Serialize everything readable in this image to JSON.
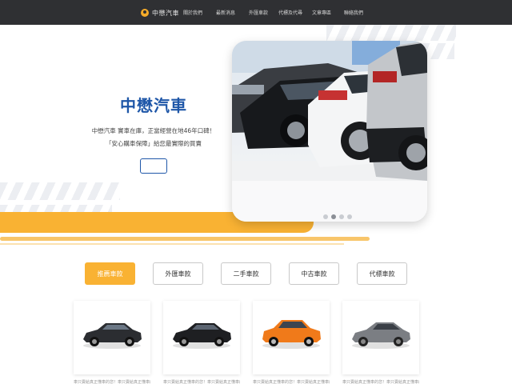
{
  "nav": {
    "brand": "中懋汽車",
    "links": [
      "關於我們",
      "最新消息",
      "外匯車款",
      "代標及代尋",
      "文章專區",
      "聯絡我們"
    ]
  },
  "hero": {
    "title": "中懋汽車",
    "desc_line1": "中懋汽車 實車在庫，正當經營在地46年口碑！",
    "desc_line2": "「安心購車保障」給您最實際的買賣",
    "button_label": "",
    "carousel_dots": 4,
    "carousel_active": 1
  },
  "tabs": [
    {
      "label": "推薦車款",
      "active": true
    },
    {
      "label": "外匯車款",
      "active": false
    },
    {
      "label": "二手車款",
      "active": false
    },
    {
      "label": "中古車款",
      "active": false
    },
    {
      "label": "代標車款",
      "active": false
    }
  ],
  "cars": [
    {
      "color": "#2b2d31",
      "caption": "車只賣給真正懂車的您！車只賣給真正懂車的您"
    },
    {
      "color": "#1e1f22",
      "caption": "車只賣給真正懂車的您！車只賣給真正懂車的您"
    },
    {
      "color": "#f07a1a",
      "caption": "車只賣給真正懂車的您！車只賣給真正懂車的您"
    },
    {
      "color": "#7b7e83",
      "caption": "車只賣給真正懂車的您！車只賣給真正懂車的您"
    }
  ],
  "colors": {
    "nav_bg": "#2f3033",
    "accent": "#f9b233",
    "brand_blue": "#1f57a8"
  }
}
